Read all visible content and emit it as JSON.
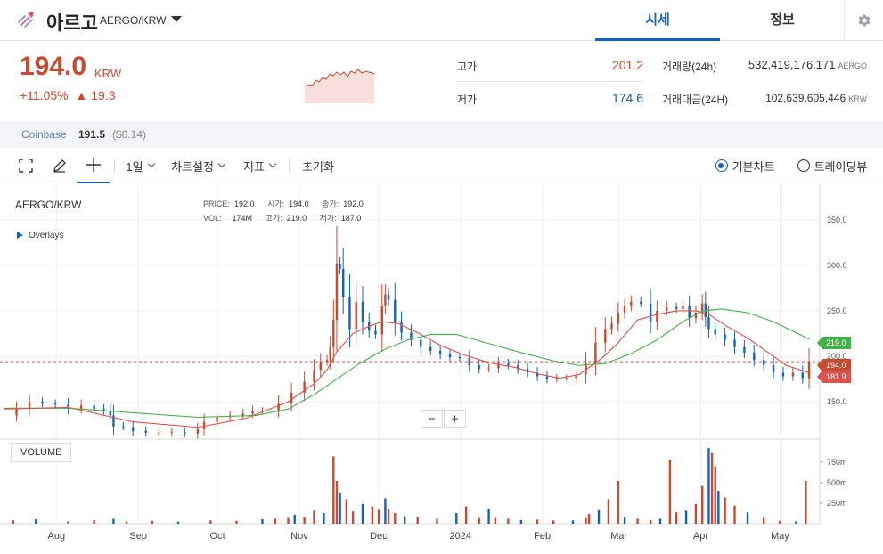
{
  "header": {
    "coin_name": "아르고",
    "pair": "AERGO/KRW",
    "tabs": [
      "시세",
      "정보"
    ]
  },
  "summary": {
    "price": "194.0",
    "unit": "KRW",
    "change_pct": "+11.05%",
    "change_abs": "▲ 19.3",
    "high_label": "고가",
    "high": "201.2",
    "low_label": "저가",
    "low": "174.6",
    "volume_label": "거래량(24h)",
    "volume": "532,419,176.171",
    "volume_unit": "AERGO",
    "turnover_label": "거래대금(24H)",
    "turnover": "102,639,605,446",
    "turnover_unit": "KRW"
  },
  "exchange": {
    "name": "Coinbase",
    "price": "191.5",
    "usd": "($0.14)"
  },
  "toolbar": {
    "interval": "1일",
    "chart_settings": "차트설정",
    "indicators": "지표",
    "reset": "초기화",
    "basic_chart": "기본차트",
    "tradingview": "트레이딩뷰"
  },
  "chart": {
    "title": "AERGO/KRW",
    "ohlc": {
      "price_label": "PRICE:",
      "price": "192.0",
      "open_label": "시가:",
      "open": "194.0",
      "close_label": "종가:",
      "close": "192.0",
      "vol_label": "VOL:",
      "vol": "174M",
      "high_label": "고가:",
      "high": "219.0",
      "low_label": "저가:",
      "low": "187.0"
    },
    "overlays_label": "Overlays",
    "volume_label": "VOLUME",
    "zoom_out": "−",
    "zoom_in": "+",
    "tags": {
      "ma_long": "219.0",
      "last": "194.0",
      "ma_short": "181.9"
    }
  },
  "chart_data": {
    "type": "candlestick",
    "title": "AERGO/KRW",
    "x_ticks": [
      "Aug",
      "Sep",
      "Oct",
      "Nov",
      "Dec",
      "2024",
      "Feb",
      "Mar",
      "Apr",
      "May"
    ],
    "y_ticks": [
      "150.0",
      "200.0",
      "250.0",
      "300.0",
      "350.0"
    ],
    "volume_ticks": [
      "250m",
      "500m",
      "750m"
    ],
    "ylim": [
      110,
      385
    ],
    "volume_ylim": [
      0,
      900
    ],
    "last_price_line": 194.0,
    "grid": true,
    "colors": {
      "up": "#c84a31",
      "down": "#1261c4",
      "ma_short": "#d9534f",
      "ma_long": "#43b04a"
    },
    "price_series": [
      [
        0,
        135
      ],
      [
        4,
        142
      ],
      [
        8,
        150
      ],
      [
        12,
        148
      ],
      [
        16,
        147
      ],
      [
        20,
        142
      ],
      [
        24,
        146
      ],
      [
        28,
        142
      ],
      [
        31,
        140
      ],
      [
        33,
        135
      ],
      [
        34,
        123
      ],
      [
        37,
        122
      ],
      [
        40,
        118
      ],
      [
        44,
        116
      ],
      [
        48,
        116
      ],
      [
        52,
        117
      ],
      [
        56,
        115
      ],
      [
        60,
        120
      ],
      [
        62,
        128
      ],
      [
        66,
        133
      ],
      [
        70,
        135
      ],
      [
        74,
        137
      ],
      [
        77,
        140
      ],
      [
        80,
        140
      ],
      [
        85,
        148
      ],
      [
        89,
        160
      ],
      [
        93,
        172
      ],
      [
        96,
        185
      ],
      [
        98,
        194
      ],
      [
        100,
        196
      ],
      [
        101,
        210
      ],
      [
        102,
        240
      ],
      [
        103,
        302
      ],
      [
        104,
        296
      ],
      [
        105,
        265
      ],
      [
        107,
        230
      ],
      [
        109,
        260
      ],
      [
        111,
        238
      ],
      [
        113,
        228
      ],
      [
        115,
        224
      ],
      [
        117,
        256
      ],
      [
        118,
        268
      ],
      [
        119,
        262
      ],
      [
        121,
        238
      ],
      [
        123,
        226
      ],
      [
        126,
        218
      ],
      [
        129,
        210
      ],
      [
        132,
        206
      ],
      [
        135,
        202
      ],
      [
        138,
        199
      ],
      [
        141,
        198
      ],
      [
        144,
        190
      ],
      [
        147,
        186
      ],
      [
        150,
        187
      ],
      [
        153,
        192
      ],
      [
        156,
        190
      ],
      [
        159,
        186
      ],
      [
        162,
        182
      ],
      [
        165,
        178
      ],
      [
        168,
        175
      ],
      [
        171,
        176
      ],
      [
        174,
        176
      ],
      [
        177,
        180
      ],
      [
        180,
        193
      ],
      [
        183,
        215
      ],
      [
        186,
        230
      ],
      [
        188,
        236
      ],
      [
        190,
        248
      ],
      [
        192,
        255
      ],
      [
        194,
        260
      ],
      [
        197,
        258
      ],
      [
        200,
        238
      ],
      [
        202,
        250
      ],
      [
        205,
        254
      ],
      [
        208,
        252
      ],
      [
        210,
        255
      ],
      [
        212,
        242
      ],
      [
        214,
        248
      ],
      [
        216,
        258
      ],
      [
        217,
        243
      ],
      [
        218,
        230
      ],
      [
        220,
        224
      ],
      [
        223,
        218
      ],
      [
        226,
        210
      ],
      [
        229,
        204
      ],
      [
        232,
        196
      ],
      [
        235,
        190
      ],
      [
        238,
        182
      ],
      [
        241,
        178
      ],
      [
        244,
        182
      ],
      [
        247,
        176
      ],
      [
        249,
        194
      ]
    ],
    "ma_short_series": [
      [
        0,
        142
      ],
      [
        20,
        144
      ],
      [
        40,
        128
      ],
      [
        60,
        122
      ],
      [
        75,
        132
      ],
      [
        88,
        150
      ],
      [
        96,
        170
      ],
      [
        100,
        185
      ],
      [
        103,
        205
      ],
      [
        108,
        225
      ],
      [
        113,
        233
      ],
      [
        117,
        238
      ],
      [
        122,
        236
      ],
      [
        128,
        226
      ],
      [
        135,
        212
      ],
      [
        142,
        202
      ],
      [
        150,
        193
      ],
      [
        158,
        188
      ],
      [
        166,
        180
      ],
      [
        172,
        176
      ],
      [
        178,
        180
      ],
      [
        185,
        198
      ],
      [
        190,
        215
      ],
      [
        196,
        240
      ],
      [
        202,
        246
      ],
      [
        208,
        250
      ],
      [
        214,
        250
      ],
      [
        218,
        246
      ],
      [
        224,
        232
      ],
      [
        230,
        220
      ],
      [
        236,
        205
      ],
      [
        242,
        190
      ],
      [
        249,
        182
      ]
    ],
    "ma_long_series": [
      [
        0,
        143
      ],
      [
        20,
        143
      ],
      [
        40,
        138
      ],
      [
        60,
        133
      ],
      [
        78,
        135
      ],
      [
        88,
        142
      ],
      [
        96,
        158
      ],
      [
        103,
        175
      ],
      [
        110,
        192
      ],
      [
        118,
        208
      ],
      [
        125,
        218
      ],
      [
        132,
        224
      ],
      [
        140,
        224
      ],
      [
        150,
        214
      ],
      [
        160,
        204
      ],
      [
        170,
        195
      ],
      [
        178,
        190
      ],
      [
        186,
        192
      ],
      [
        194,
        203
      ],
      [
        202,
        218
      ],
      [
        210,
        238
      ],
      [
        216,
        250
      ],
      [
        222,
        252
      ],
      [
        230,
        248
      ],
      [
        238,
        238
      ],
      [
        249,
        219
      ]
    ],
    "volume_series": [
      [
        3,
        40
      ],
      [
        10,
        55
      ],
      [
        20,
        30
      ],
      [
        28,
        45
      ],
      [
        34,
        60
      ],
      [
        38,
        28
      ],
      [
        46,
        35
      ],
      [
        54,
        25
      ],
      [
        64,
        40
      ],
      [
        72,
        35
      ],
      [
        80,
        55
      ],
      [
        84,
        60
      ],
      [
        88,
        70
      ],
      [
        90,
        110
      ],
      [
        93,
        75
      ],
      [
        96,
        160
      ],
      [
        99,
        130
      ],
      [
        102,
        820
      ],
      [
        103,
        520
      ],
      [
        104,
        380
      ],
      [
        106,
        300
      ],
      [
        108,
        150
      ],
      [
        111,
        240
      ],
      [
        114,
        210
      ],
      [
        116,
        170
      ],
      [
        118,
        310
      ],
      [
        119,
        180
      ],
      [
        121,
        130
      ],
      [
        124,
        90
      ],
      [
        128,
        80
      ],
      [
        134,
        60
      ],
      [
        140,
        130
      ],
      [
        143,
        210
      ],
      [
        147,
        70
      ],
      [
        150,
        185
      ],
      [
        152,
        70
      ],
      [
        156,
        60
      ],
      [
        160,
        45
      ],
      [
        165,
        50
      ],
      [
        170,
        40
      ],
      [
        176,
        40
      ],
      [
        180,
        70
      ],
      [
        181,
        120
      ],
      [
        184,
        165
      ],
      [
        187,
        300
      ],
      [
        190,
        520
      ],
      [
        192,
        80
      ],
      [
        196,
        60
      ],
      [
        200,
        45
      ],
      [
        203,
        60
      ],
      [
        206,
        780
      ],
      [
        208,
        140
      ],
      [
        211,
        160
      ],
      [
        214,
        240
      ],
      [
        216,
        460
      ],
      [
        218,
        920
      ],
      [
        219,
        860
      ],
      [
        220,
        700
      ],
      [
        221,
        400
      ],
      [
        223,
        320
      ],
      [
        226,
        220
      ],
      [
        230,
        140
      ],
      [
        235,
        70
      ],
      [
        240,
        35
      ],
      [
        245,
        30
      ],
      [
        248,
        520
      ]
    ]
  }
}
